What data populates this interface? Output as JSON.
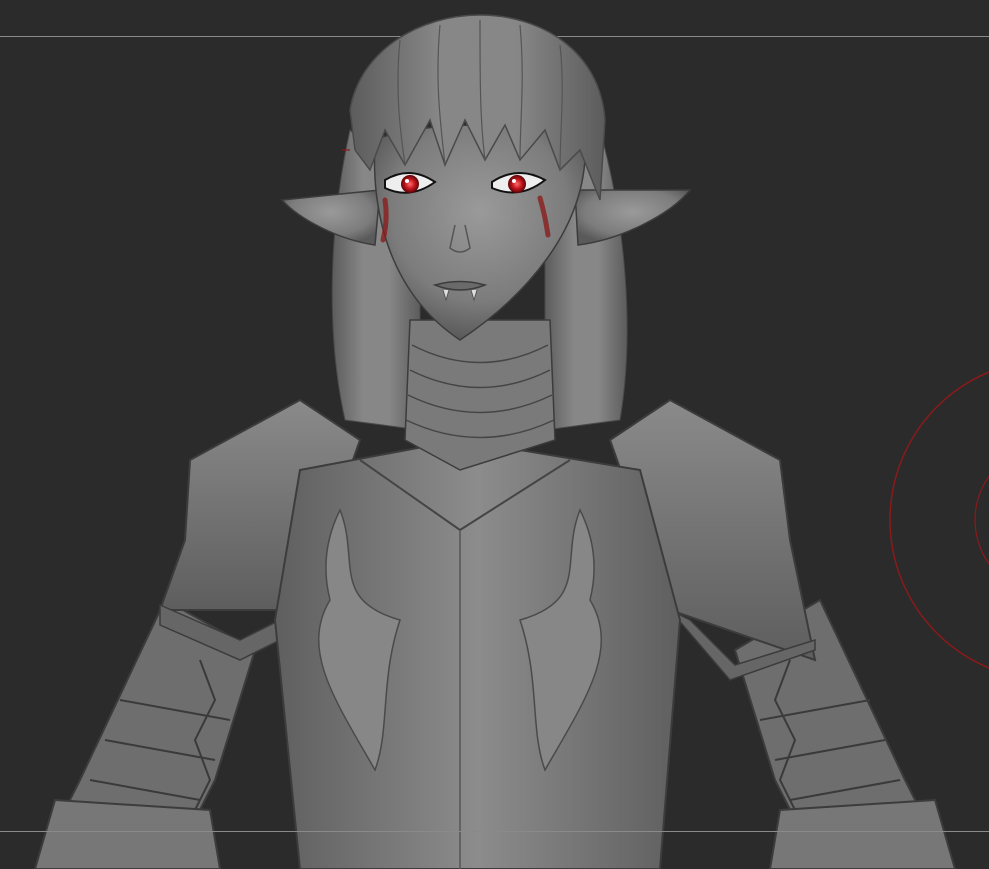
{
  "viewport": {
    "background": "#2b2b2b",
    "guide_color": "#8a8a8a",
    "brush_color": "#8b1a1a"
  },
  "model": {
    "material_color": "#7a7a7a",
    "eye_color": "#c0141c",
    "tear_mark_color": "#8a1d1d"
  }
}
